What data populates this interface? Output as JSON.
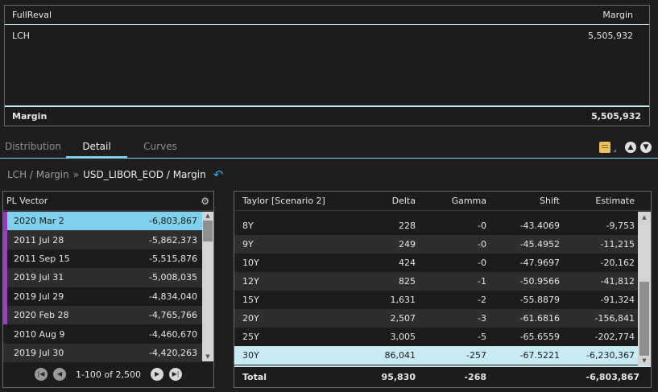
{
  "summary": {
    "header_left": "FullReval",
    "header_right": "Margin",
    "row": {
      "name": "LCH",
      "value": "5,505,932"
    },
    "footer": {
      "label": "Margin",
      "value": "5,505,932"
    }
  },
  "tabs": [
    {
      "label": "Distribution",
      "active": false
    },
    {
      "label": "Detail",
      "active": true
    },
    {
      "label": "Curves",
      "active": false
    }
  ],
  "toolbar_icons": [
    "note-icon",
    "expand-all-icon",
    "collapse-all-icon"
  ],
  "breadcrumb": {
    "first": "LCH / Margin",
    "separator": "»",
    "current": "USD_LIBOR_EOD / Margin",
    "back_icon": "undo-arrow-icon"
  },
  "pl_vector": {
    "title": "PL Vector",
    "settings_icon": "gear-icon",
    "rows": [
      {
        "date": "2020 Mar 2",
        "value": "-6,803,867",
        "selected": true,
        "marked": true
      },
      {
        "date": "2011 Jul 28",
        "value": "-5,862,373",
        "selected": false,
        "marked": true
      },
      {
        "date": "2011 Sep 15",
        "value": "-5,515,876",
        "selected": false,
        "marked": true
      },
      {
        "date": "2019 Jul 31",
        "value": "-5,008,035",
        "selected": false,
        "marked": true
      },
      {
        "date": "2019 Jul 29",
        "value": "-4,834,040",
        "selected": false,
        "marked": true
      },
      {
        "date": "2020 Feb 28",
        "value": "-4,765,766",
        "selected": false,
        "marked": true
      },
      {
        "date": "2010 Aug 9",
        "value": "-4,460,670",
        "selected": false,
        "marked": false
      },
      {
        "date": "2019 Jul 30",
        "value": "-4,420,263",
        "selected": false,
        "marked": false
      }
    ],
    "pager": {
      "info": "1-100 of 2,500"
    }
  },
  "taylor": {
    "columns": [
      "Taylor [Scenario 2]",
      "Delta",
      "Gamma",
      "Shift",
      "Estimate"
    ],
    "rows": [
      [
        "8Y",
        "228",
        "-0",
        "-43.4069",
        "-9,753"
      ],
      [
        "9Y",
        "249",
        "-0",
        "-45.4952",
        "-11,215"
      ],
      [
        "10Y",
        "424",
        "-0",
        "-47.9697",
        "-20,162"
      ],
      [
        "12Y",
        "825",
        "-1",
        "-50.9566",
        "-41,812"
      ],
      [
        "15Y",
        "1,631",
        "-2",
        "-55.8879",
        "-91,324"
      ],
      [
        "20Y",
        "2,507",
        "-3",
        "-61.6816",
        "-156,841"
      ],
      [
        "25Y",
        "3,005",
        "-5",
        "-65.6559",
        "-202,774"
      ],
      [
        "30Y",
        "86,041",
        "-257",
        "-67.5221",
        "-6,230,367"
      ]
    ],
    "selected_row": 7,
    "total": [
      "Total",
      "95,830",
      "-268",
      "",
      "-6,803,867"
    ]
  }
}
